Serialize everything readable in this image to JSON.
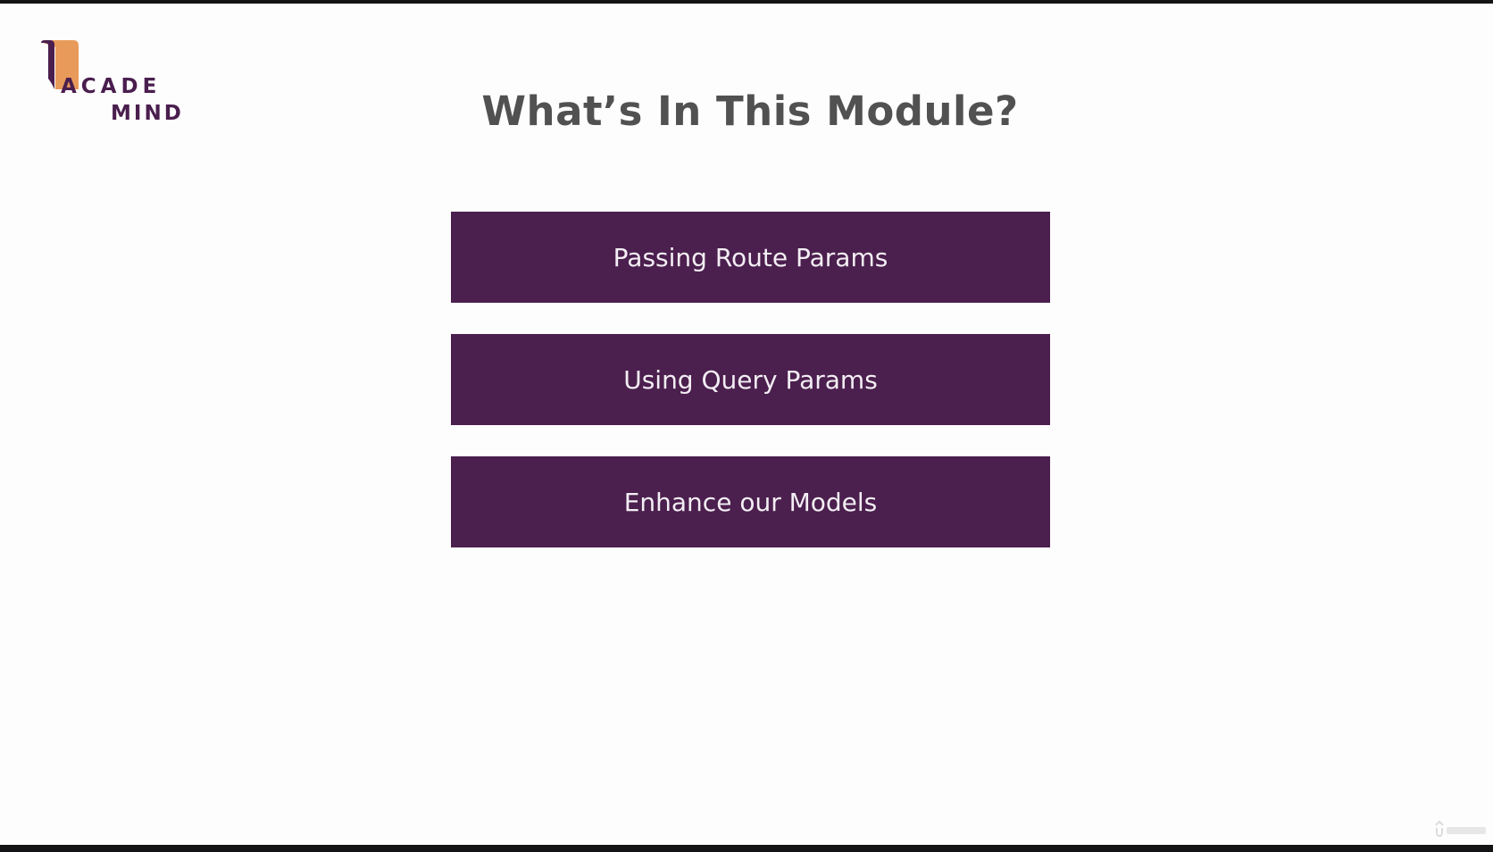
{
  "brand": {
    "line1": "ACADE",
    "line2": "MIND",
    "colors": {
      "mark": "#e89a5a",
      "text": "#4a1e4e"
    }
  },
  "slide": {
    "title": "What’s In This Module?",
    "topics": [
      "Passing Route Params",
      "Using Query Params",
      "Enhance our Models"
    ],
    "colors": {
      "title": "#515151",
      "topic_background": "#4b1f4e",
      "topic_text": "#f3eef4",
      "slide_background": "#fefdfe",
      "frame": "#141416"
    }
  },
  "watermark": {
    "icon": "udemy-logo-icon"
  }
}
